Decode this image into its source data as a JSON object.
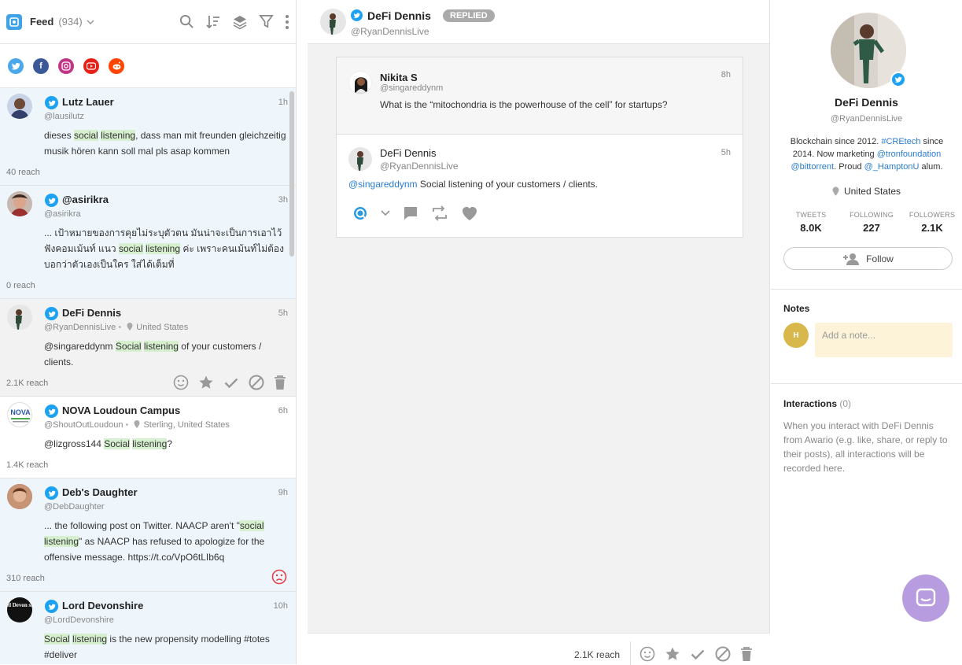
{
  "feed": {
    "title": "Feed",
    "count": "(934)"
  },
  "items": [
    {
      "name": "Lutz Lauer",
      "time": "1h",
      "handle": "@lausilutz",
      "text_parts": [
        "dieses ",
        "social",
        " ",
        "listening",
        ", dass man mit freunden gleichzeitig musik hören kann soll mal pls asap kommen"
      ],
      "reach": "40 reach"
    },
    {
      "name": "@asirikra",
      "time": "3h",
      "handle": "@asirikra",
      "text_parts": [
        "... เป้าหมายของการคุยไม่ระบุตัวตน มันน่าจะเป็นการเอาไว้ฟังคอมเม้นท์ แนว ",
        "social",
        " ",
        "listening",
        " ค่ะ เพราะคนเม้นท์ไม่ต้องบอกว่าตัวเองเป็นใคร ใส่ได้เต็มที่"
      ],
      "reach": "0 reach"
    },
    {
      "name": "DeFi Dennis",
      "time": "5h",
      "handle": "@RyanDennisLive",
      "location": "United States",
      "text_parts": [
        "@singareddynm ",
        "Social",
        " ",
        "listening",
        " of your customers / clients."
      ],
      "reach": "2.1K reach"
    },
    {
      "name": "NOVA Loudoun Campus",
      "time": "6h",
      "handle": "@ShoutOutLoudoun",
      "location": "Sterling, United States",
      "text_parts": [
        "@lizgross144 ",
        "Social",
        " ",
        "listening",
        "?"
      ],
      "reach": "1.4K reach",
      "avatar_text": "NOVA"
    },
    {
      "name": "Deb's Daughter",
      "time": "9h",
      "handle": "@DebDaughter",
      "text_parts": [
        "... the following post on Twitter. NAACP aren't \"",
        "social",
        " ",
        "listening",
        "\" as NAACP has refused to apologize for the offensive message. https://t.co/VpO6tLIb6q"
      ],
      "reach": "310 reach"
    },
    {
      "name": "Lord Devonshire",
      "time": "10h",
      "handle": "@LordDevonshire",
      "text_parts": [
        "",
        "Social",
        " ",
        "listening",
        " is the new propensity modelling #totes #deliver"
      ],
      "avatar_text": "Lord Devon shire"
    }
  ],
  "conversation": {
    "header_name": "DeFi Dennis",
    "header_handle": "@RyanDennisLive",
    "status": "REPLIED",
    "parent": {
      "name": "Nikita S",
      "handle": "@singareddynm",
      "time": "8h",
      "text": "What is the “mitochondria is the powerhouse of the cell” for startups?"
    },
    "reply": {
      "name": "DeFi Dennis",
      "handle": "@RyanDennisLive",
      "time": "5h",
      "mention": "@singareddynm",
      "text": " Social listening of your customers / clients."
    },
    "footer_reach": "2.1K reach"
  },
  "profile": {
    "name": "DeFi Dennis",
    "handle": "@RyanDennisLive",
    "bio": [
      "Blockchain since 2012. ",
      "#CREtech",
      " since 2014. Now marketing ",
      "@tronfoundation",
      " ",
      "@bittorrent",
      ". Proud ",
      "@_HamptonU",
      " alum."
    ],
    "location": "United States",
    "stats": [
      {
        "label": "TWEETS",
        "value": "8.0K"
      },
      {
        "label": "FOLLOWING",
        "value": "227"
      },
      {
        "label": "FOLLOWERS",
        "value": "2.1K"
      }
    ],
    "follow_label": "Follow"
  },
  "notes": {
    "title": "Notes",
    "avatar_initial": "H",
    "placeholder": "Add a note..."
  },
  "interactions": {
    "title": "Interactions",
    "count": "(0)",
    "text": "When you interact with DeFi Dennis from Awario (e.g. like, share, or reply to their posts), all interactions will be recorded here."
  },
  "colors": {
    "twitter": "#1da1f2",
    "highlight": "#d6f0cf",
    "link": "#2a7ccf",
    "chat_bubble": "#b79de0",
    "negative_sentiment": "#e0414a"
  }
}
